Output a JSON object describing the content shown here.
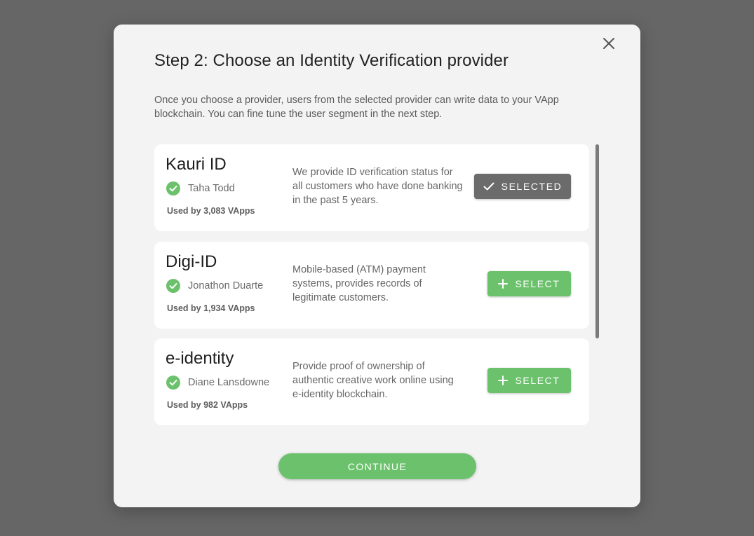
{
  "modal": {
    "title": "Step 2: Choose an Identity Verification provider",
    "description": "Once you choose a provider,  users from the selected provider can write data to your VApp blockchain. You can fine tune the user segment in the next step.",
    "close_icon": "close-icon",
    "continue_label": "CONTINUE"
  },
  "providers": [
    {
      "name": "Kauri ID",
      "verifier": "Taha Todd",
      "usage": "Used by 3,083 VApps",
      "description": "We provide ID verification status for all customers who have done banking in the past 5 years.",
      "button_label": "SELECTED",
      "button_icon": "check-icon",
      "selected": true
    },
    {
      "name": "Digi-ID",
      "verifier": "Jonathon Duarte",
      "usage": "Used by 1,934 VApps",
      "description": "Mobile-based (ATM) payment systems, provides records of legitimate customers.",
      "button_label": "SELECT",
      "button_icon": "plus-icon",
      "selected": false
    },
    {
      "name": "e-identity",
      "verifier": "Diane Lansdowne",
      "usage": "Used by 982 VApps",
      "description": "Provide proof of ownership of authentic creative work online using e-identity blockchain.",
      "button_label": "SELECT",
      "button_icon": "plus-icon",
      "selected": false
    }
  ],
  "colors": {
    "overlay": "#666666",
    "modal_bg": "#f3f3f3",
    "accent_green": "#6cc26c",
    "selected_gray": "#6b6b6b"
  }
}
